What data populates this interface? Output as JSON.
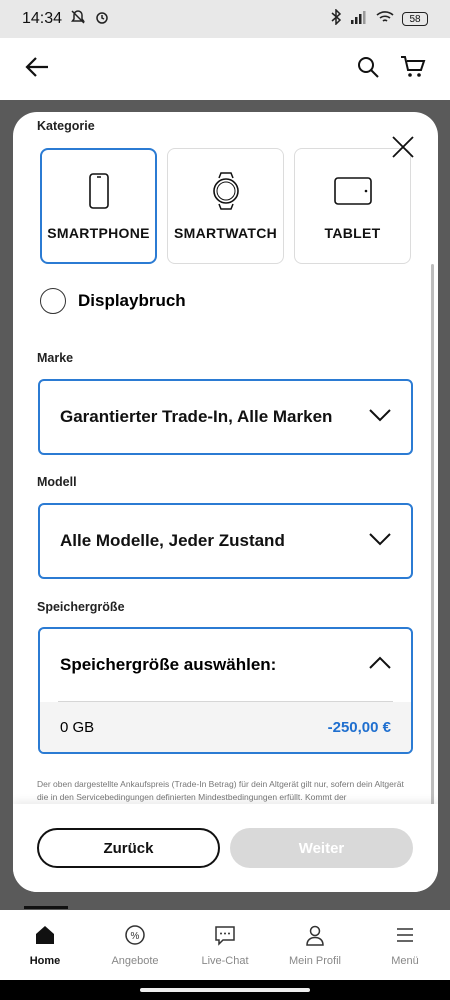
{
  "status_bar": {
    "time": "14:34",
    "battery": "58"
  },
  "modal": {
    "category_label": "Kategorie",
    "categories": [
      {
        "label": "SMARTPHONE",
        "icon": "smartphone-icon",
        "selected": true
      },
      {
        "label": "SMARTWATCH",
        "icon": "smartwatch-icon",
        "selected": false
      },
      {
        "label": "TABLET",
        "icon": "tablet-icon",
        "selected": false
      }
    ],
    "display_broken_label": "Displaybruch",
    "brand_label": "Marke",
    "brand_value": "Garantierter Trade-In, Alle Marken",
    "model_label": "Modell",
    "model_value": "Alle Modelle, Jeder Zustand",
    "storage_label": "Speichergröße",
    "storage_prompt": "Speichergröße auswählen:",
    "storage_option": {
      "size": "0 GB",
      "price": "-250,00 €"
    },
    "disclaimer": "Der oben dargestellte Ankaufspreis (Trade-In Betrag) für dein Altgerät gilt nur, sofern dein Altgerät die in den Servicebedingungen definierten Mindestbedingungen erfüllt. Kommt der",
    "back_button": "Zurück",
    "next_button": "Weiter"
  },
  "bottom_nav": {
    "items": [
      {
        "label": "Home",
        "icon": "home-icon",
        "active": true
      },
      {
        "label": "Angebote",
        "icon": "offers-icon",
        "active": false
      },
      {
        "label": "Live-Chat",
        "icon": "chat-icon",
        "active": false
      },
      {
        "label": "Mein Profil",
        "icon": "profile-icon",
        "active": false
      },
      {
        "label": "Menü",
        "icon": "menu-icon",
        "active": false
      }
    ]
  },
  "colors": {
    "accent": "#2b7bd3",
    "price": "#1f6fcf",
    "disabled": "#d9d9d9"
  }
}
